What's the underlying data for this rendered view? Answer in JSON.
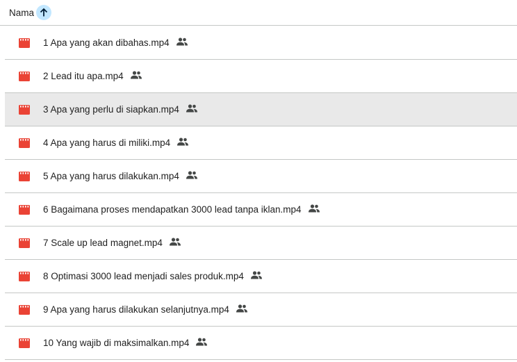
{
  "header": {
    "column_label": "Nama",
    "sort_icon": "arrow-up-icon",
    "sort_accent": "#c2e7ff"
  },
  "files": [
    {
      "name": "1 Apa yang akan dibahas.mp4",
      "icon": "video-file-icon",
      "shared": true,
      "selected": false
    },
    {
      "name": "2 Lead itu apa.mp4",
      "icon": "video-file-icon",
      "shared": true,
      "selected": false
    },
    {
      "name": "3 Apa yang perlu di siapkan.mp4",
      "icon": "video-file-icon",
      "shared": true,
      "selected": true
    },
    {
      "name": "4 Apa yang harus di miliki.mp4",
      "icon": "video-file-icon",
      "shared": true,
      "selected": false
    },
    {
      "name": "5 Apa yang harus dilakukan.mp4",
      "icon": "video-file-icon",
      "shared": true,
      "selected": false
    },
    {
      "name": "6 Bagaimana proses mendapatkan 3000 lead tanpa iklan.mp4",
      "icon": "video-file-icon",
      "shared": true,
      "selected": false
    },
    {
      "name": "7 Scale up lead magnet.mp4",
      "icon": "video-file-icon",
      "shared": true,
      "selected": false
    },
    {
      "name": "8 Optimasi 3000 lead menjadi sales produk.mp4",
      "icon": "video-file-icon",
      "shared": true,
      "selected": false
    },
    {
      "name": "9 Apa yang harus dilakukan selanjutnya.mp4",
      "icon": "video-file-icon",
      "shared": true,
      "selected": false
    },
    {
      "name": "10 Yang wajib di maksimalkan.mp4",
      "icon": "video-file-icon",
      "shared": true,
      "selected": false
    }
  ],
  "colors": {
    "video_icon": "#ea4335",
    "text": "#1f1f1f",
    "divider": "#c4c7c5",
    "selected_row": "#e9e9e9"
  }
}
